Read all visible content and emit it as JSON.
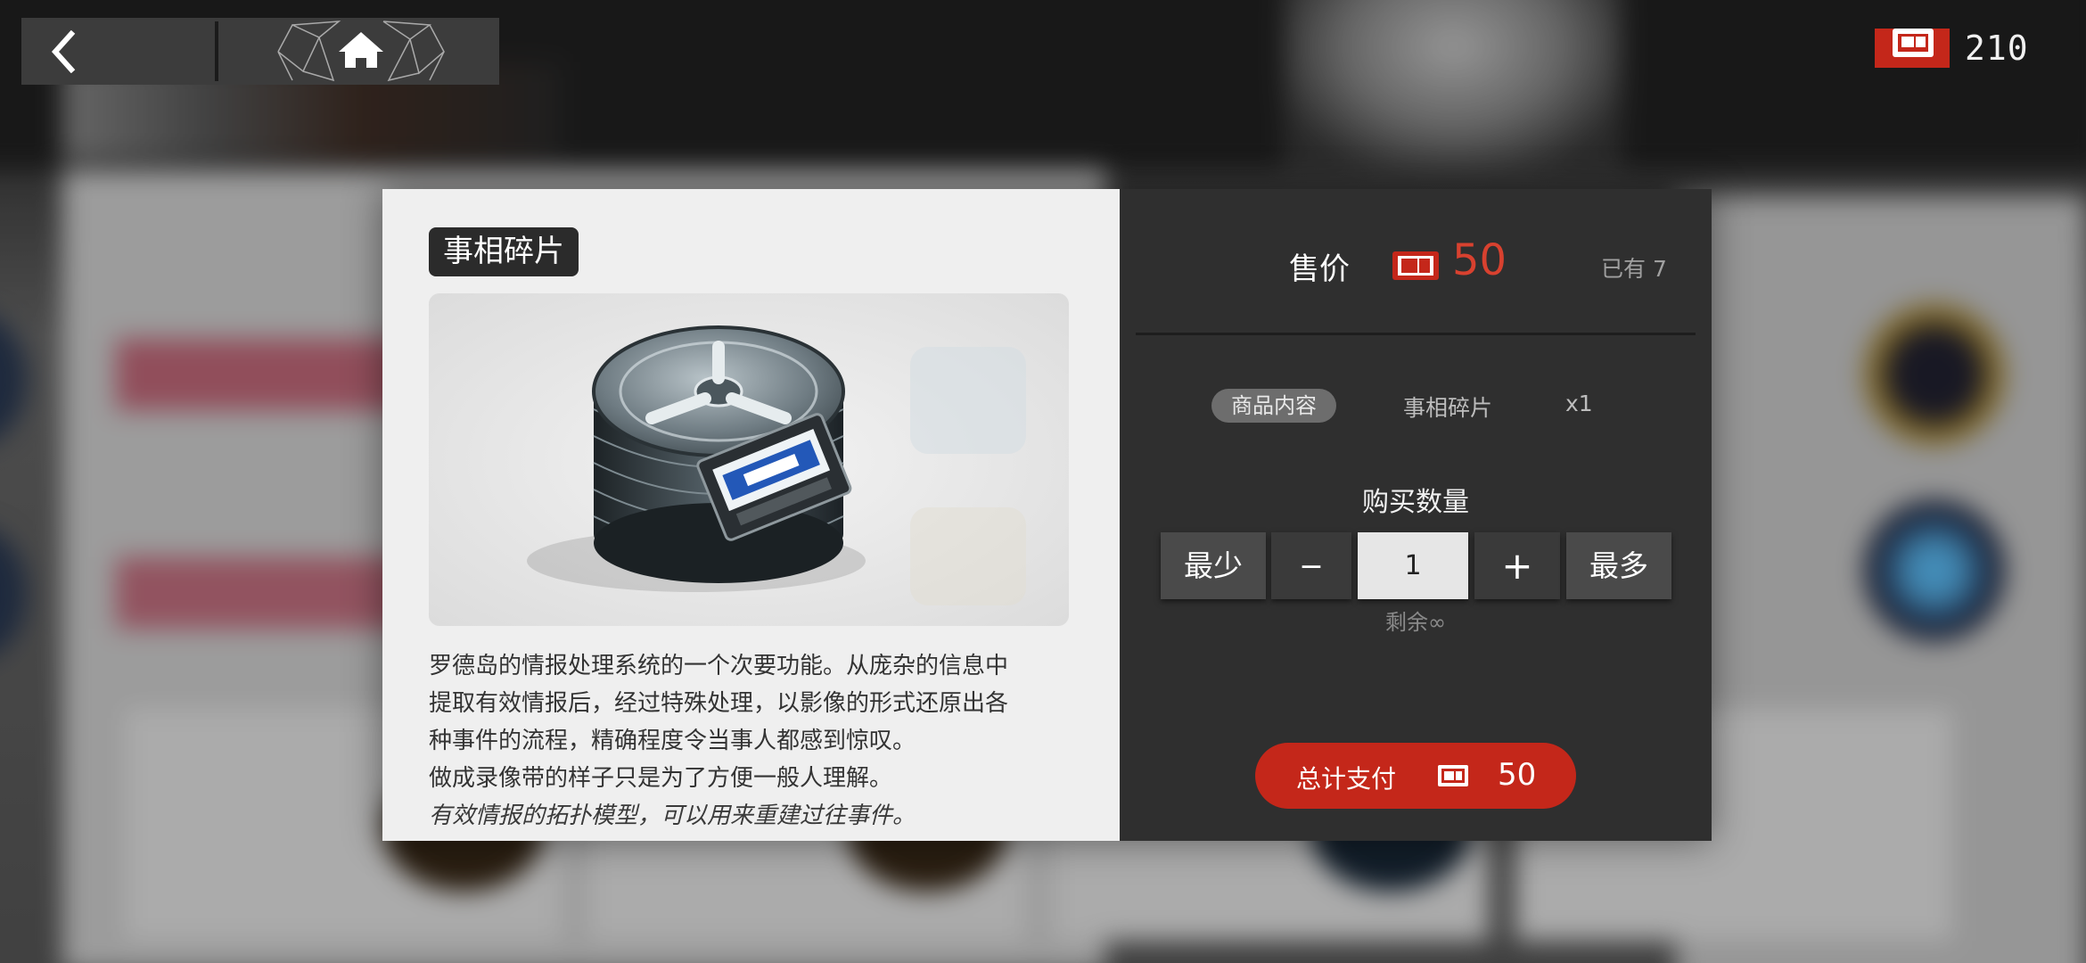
{
  "nav": {
    "back_label": "",
    "home_label": ""
  },
  "currency": {
    "amount": "210",
    "icon": "card-ticket-icon",
    "accent": "#c4271a"
  },
  "item": {
    "title": "事相碎片",
    "image": "film-reels-and-tape-cassette",
    "description_lines": [
      "罗德岛的情报处理系统的一个次要功能。从庞杂的信息中",
      "提取有效情报后，经过特殊处理，以影像的形式还原出各",
      "种事件的流程，精确程度令当事人都感到惊叹。",
      "做成录像带的样子只是为了方便一般人理解。"
    ],
    "flavor_text": "有效情报的拓扑模型，可以用来重建过往事件。"
  },
  "purchase": {
    "price_label": "售价",
    "price_value": "50",
    "owned_text": "已有 7",
    "content_badge": "商品内容",
    "content_name": "事相碎片",
    "content_qty": "x1",
    "quantity_label": "购买数量",
    "min_label": "最少",
    "minus_label": "−",
    "quantity_value": "1",
    "plus_label": "+",
    "max_label": "最多",
    "remaining_text": "剩余∞",
    "total_label": "总计支付",
    "total_value": "50"
  }
}
